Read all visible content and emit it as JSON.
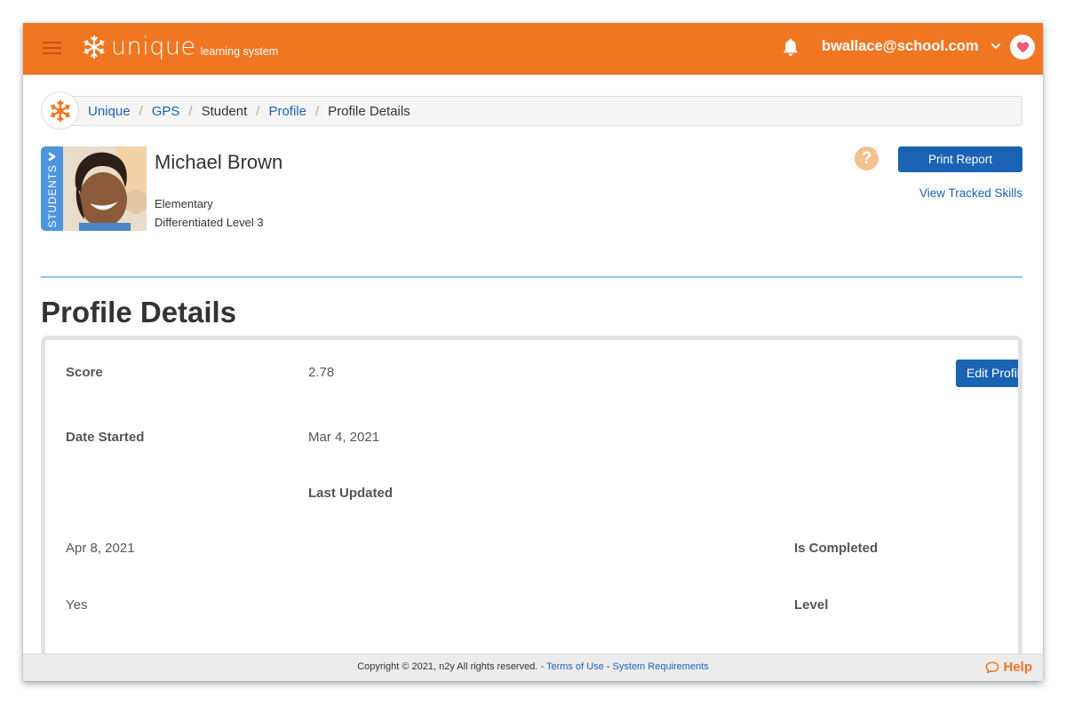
{
  "header": {
    "brand_word": "unique",
    "brand_sub": "learning system",
    "user_email": "bwallace@school.com",
    "colors": {
      "brand_orange": "#f07622",
      "link_blue": "#1a62b4"
    }
  },
  "breadcrumb": {
    "items": [
      {
        "label": "Unique",
        "link": true
      },
      {
        "label": "GPS",
        "link": true
      },
      {
        "label": "Student",
        "link": false
      },
      {
        "label": "Profile",
        "link": true
      },
      {
        "label": "Profile Details",
        "link": false
      }
    ],
    "separator": "/"
  },
  "student": {
    "tab_label": "STUDENTS",
    "name": "Michael Brown",
    "grade_band": "Elementary",
    "level": "Differentiated Level 3"
  },
  "actions": {
    "help_glyph": "?",
    "print_report": "Print Report",
    "view_tracked_skills": "View Tracked Skills"
  },
  "page": {
    "title": "Profile Details"
  },
  "profile": {
    "edit_button": "Edit Profile",
    "fields": {
      "score_label": "Score",
      "score_value": "2.78",
      "date_started_label": "Date Started",
      "date_started_value": "Mar 4, 2021",
      "last_updated_label": "Last Updated",
      "last_updated_value": "Apr 8, 2021",
      "is_completed_label": "Is Completed",
      "is_completed_value": "Yes",
      "level_label": "Level"
    }
  },
  "footer": {
    "copyright": "Copyright © 2021, n2y All rights reserved. - ",
    "terms": "Terms of Use",
    "sep": " - ",
    "system_requirements": "System Requirements",
    "help": "Help"
  }
}
